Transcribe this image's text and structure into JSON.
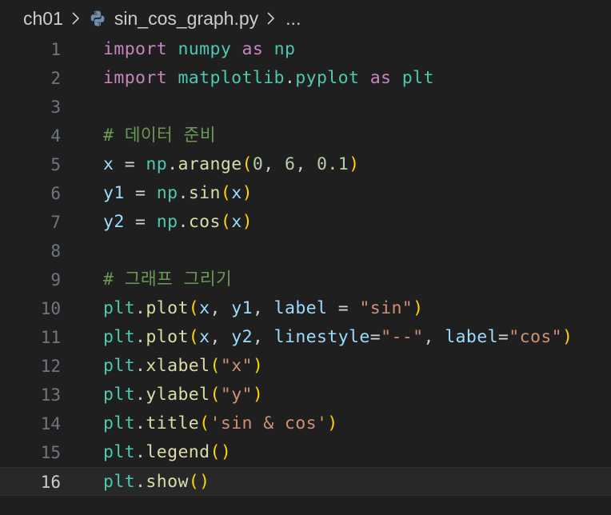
{
  "breadcrumb": {
    "folder": "ch01",
    "file": "sin_cos_graph.py",
    "ellipsis": "..."
  },
  "editor": {
    "current_line": 16,
    "lines": [
      {
        "number": "1",
        "tokens": [
          {
            "t": "import",
            "c": "kw"
          },
          {
            "t": " "
          },
          {
            "t": "numpy",
            "c": "mod"
          },
          {
            "t": " "
          },
          {
            "t": "as",
            "c": "kw"
          },
          {
            "t": " "
          },
          {
            "t": "np",
            "c": "mod"
          }
        ]
      },
      {
        "number": "2",
        "tokens": [
          {
            "t": "import",
            "c": "kw"
          },
          {
            "t": " "
          },
          {
            "t": "matplotlib",
            "c": "mod"
          },
          {
            "t": "."
          },
          {
            "t": "pyplot",
            "c": "mod"
          },
          {
            "t": " "
          },
          {
            "t": "as",
            "c": "kw"
          },
          {
            "t": " "
          },
          {
            "t": "plt",
            "c": "mod"
          }
        ]
      },
      {
        "number": "3",
        "tokens": []
      },
      {
        "number": "4",
        "tokens": [
          {
            "t": "# 데이터 준비",
            "c": "cmt"
          }
        ]
      },
      {
        "number": "5",
        "tokens": [
          {
            "t": "x",
            "c": "var"
          },
          {
            "t": " = ",
            "c": "op"
          },
          {
            "t": "np",
            "c": "mod"
          },
          {
            "t": "."
          },
          {
            "t": "arange",
            "c": "fn"
          },
          {
            "t": "(",
            "c": "b1"
          },
          {
            "t": "0",
            "c": "num"
          },
          {
            "t": ", "
          },
          {
            "t": "6",
            "c": "num"
          },
          {
            "t": ", "
          },
          {
            "t": "0.1",
            "c": "num"
          },
          {
            "t": ")",
            "c": "b1"
          }
        ]
      },
      {
        "number": "6",
        "tokens": [
          {
            "t": "y1",
            "c": "var"
          },
          {
            "t": " = ",
            "c": "op"
          },
          {
            "t": "np",
            "c": "mod"
          },
          {
            "t": "."
          },
          {
            "t": "sin",
            "c": "fn"
          },
          {
            "t": "(",
            "c": "b1"
          },
          {
            "t": "x",
            "c": "var"
          },
          {
            "t": ")",
            "c": "b1"
          }
        ]
      },
      {
        "number": "7",
        "tokens": [
          {
            "t": "y2",
            "c": "var"
          },
          {
            "t": " = ",
            "c": "op"
          },
          {
            "t": "np",
            "c": "mod"
          },
          {
            "t": "."
          },
          {
            "t": "cos",
            "c": "fn"
          },
          {
            "t": "(",
            "c": "b1"
          },
          {
            "t": "x",
            "c": "var"
          },
          {
            "t": ")",
            "c": "b1"
          }
        ]
      },
      {
        "number": "8",
        "tokens": []
      },
      {
        "number": "9",
        "tokens": [
          {
            "t": "# 그래프 그리기",
            "c": "cmt"
          }
        ]
      },
      {
        "number": "10",
        "tokens": [
          {
            "t": "plt",
            "c": "mod"
          },
          {
            "t": "."
          },
          {
            "t": "plot",
            "c": "fn"
          },
          {
            "t": "(",
            "c": "b1"
          },
          {
            "t": "x",
            "c": "var"
          },
          {
            "t": ", "
          },
          {
            "t": "y1",
            "c": "var"
          },
          {
            "t": ", "
          },
          {
            "t": "label",
            "c": "var"
          },
          {
            "t": " = ",
            "c": "op"
          },
          {
            "t": "\"sin\"",
            "c": "str"
          },
          {
            "t": ")",
            "c": "b1"
          }
        ]
      },
      {
        "number": "11",
        "tokens": [
          {
            "t": "plt",
            "c": "mod"
          },
          {
            "t": "."
          },
          {
            "t": "plot",
            "c": "fn"
          },
          {
            "t": "(",
            "c": "b1"
          },
          {
            "t": "x",
            "c": "var"
          },
          {
            "t": ", "
          },
          {
            "t": "y2",
            "c": "var"
          },
          {
            "t": ", "
          },
          {
            "t": "linestyle",
            "c": "var"
          },
          {
            "t": "=",
            "c": "op"
          },
          {
            "t": "\"--\"",
            "c": "str"
          },
          {
            "t": ", "
          },
          {
            "t": "label",
            "c": "var"
          },
          {
            "t": "=",
            "c": "op"
          },
          {
            "t": "\"cos\"",
            "c": "str"
          },
          {
            "t": ")",
            "c": "b1"
          }
        ]
      },
      {
        "number": "12",
        "tokens": [
          {
            "t": "plt",
            "c": "mod"
          },
          {
            "t": "."
          },
          {
            "t": "xlabel",
            "c": "fn"
          },
          {
            "t": "(",
            "c": "b1"
          },
          {
            "t": "\"x\"",
            "c": "str"
          },
          {
            "t": ")",
            "c": "b1"
          }
        ]
      },
      {
        "number": "13",
        "tokens": [
          {
            "t": "plt",
            "c": "mod"
          },
          {
            "t": "."
          },
          {
            "t": "ylabel",
            "c": "fn"
          },
          {
            "t": "(",
            "c": "b1"
          },
          {
            "t": "\"y\"",
            "c": "str"
          },
          {
            "t": ")",
            "c": "b1"
          }
        ]
      },
      {
        "number": "14",
        "tokens": [
          {
            "t": "plt",
            "c": "mod"
          },
          {
            "t": "."
          },
          {
            "t": "title",
            "c": "fn"
          },
          {
            "t": "(",
            "c": "b1"
          },
          {
            "t": "'sin & cos'",
            "c": "str"
          },
          {
            "t": ")",
            "c": "b1"
          }
        ]
      },
      {
        "number": "15",
        "tokens": [
          {
            "t": "plt",
            "c": "mod"
          },
          {
            "t": "."
          },
          {
            "t": "legend",
            "c": "fn"
          },
          {
            "t": "()",
            "c": "b1"
          }
        ]
      },
      {
        "number": "16",
        "tokens": [
          {
            "t": "plt",
            "c": "mod"
          },
          {
            "t": "."
          },
          {
            "t": "show",
            "c": "fn"
          },
          {
            "t": "()",
            "c": "b1"
          }
        ]
      }
    ]
  },
  "icons": {
    "separator": "chevron-right-icon",
    "file_type": "python-file-icon"
  },
  "colors": {
    "background": "#1f1f1f",
    "current_line": "#282828",
    "line_number": "#6e7681",
    "line_number_active": "#cccccc",
    "keyword": "#c586c0",
    "module": "#4ec9b0",
    "variable": "#9cdcfe",
    "function": "#dcdcaa",
    "number": "#b5cea8",
    "string": "#ce9178",
    "comment": "#6a9955",
    "bracket": "#ffd700"
  }
}
